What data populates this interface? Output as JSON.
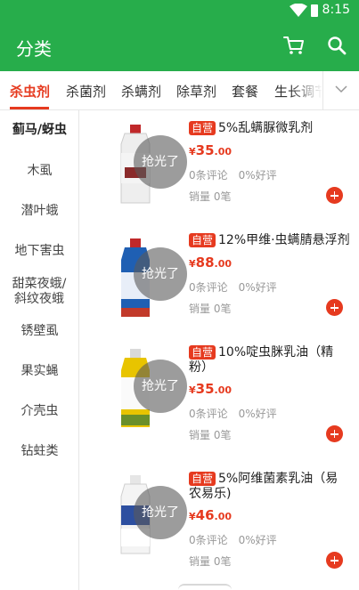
{
  "status_bar": {
    "time": "8:15"
  },
  "app_bar": {
    "title": "分类",
    "cart_icon": "cart-icon",
    "search_icon": "search-icon"
  },
  "colors": {
    "primary": "#27ad4b",
    "accent": "#e63a1f"
  },
  "tabs": [
    {
      "label": "杀虫剂",
      "active": true
    },
    {
      "label": "杀菌剂"
    },
    {
      "label": "杀螨剂"
    },
    {
      "label": "除草剂"
    },
    {
      "label": "套餐"
    },
    {
      "label": "生长调节剂"
    }
  ],
  "sidebar": {
    "items": [
      {
        "label": "蓟马/蚜虫",
        "active": true
      },
      {
        "label": "木虱"
      },
      {
        "label": "潜叶蛾"
      },
      {
        "label": "地下害虫"
      },
      {
        "label": "甜菜夜蛾/斜纹夜蛾"
      },
      {
        "label": "锈壁虱"
      },
      {
        "label": "果实蝇"
      },
      {
        "label": "介壳虫"
      },
      {
        "label": "钻蛀类"
      }
    ]
  },
  "products": [
    {
      "badge": "自营",
      "title": "5%乱螨脲微乳剂",
      "currency": "¥",
      "price_int": "35",
      "price_dec": ".00",
      "comments": "0条评论",
      "rating": "0%好评",
      "sales": "销量 0笔",
      "soldout": "抢光了"
    },
    {
      "badge": "自营",
      "title": "12%甲维·虫螨腈悬浮剂",
      "currency": "¥",
      "price_int": "88",
      "price_dec": ".00",
      "comments": "0条评论",
      "rating": "0%好评",
      "sales": "销量 0笔",
      "soldout": "抢光了"
    },
    {
      "badge": "自营",
      "title": "10%啶虫脒乳油（精粉）",
      "currency": "¥",
      "price_int": "35",
      "price_dec": ".00",
      "comments": "0条评论",
      "rating": "0%好评",
      "sales": "销量 0笔",
      "soldout": "抢光了"
    },
    {
      "badge": "自营",
      "title": "5%阿维菌素乳油（易农易乐)",
      "currency": "¥",
      "price_int": "46",
      "price_dec": ".00",
      "comments": "0条评论",
      "rating": "0%好评",
      "sales": "销量 0笔",
      "soldout": "抢光了"
    }
  ]
}
